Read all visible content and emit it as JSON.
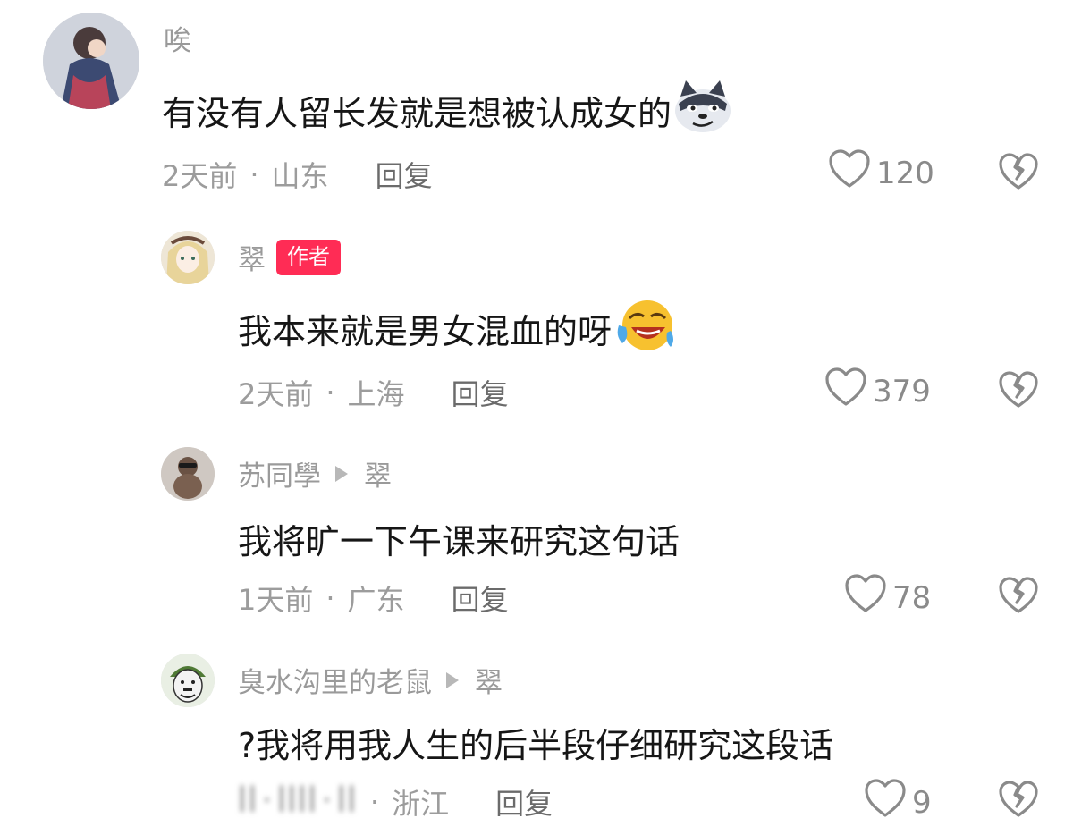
{
  "comments": [
    {
      "username": "唉",
      "content": "有没有人留长发就是想被认成女的",
      "emoji": "wolf-grin-emoji",
      "time": "2天前",
      "location": "山东",
      "reply_label": "回复",
      "likes": "120"
    },
    {
      "username": "翠",
      "badge": "作者",
      "content": "我本来就是男女混血的呀",
      "emoji": "laugh-cry-emoji",
      "time": "2天前",
      "location": "上海",
      "reply_label": "回复",
      "likes": "379"
    },
    {
      "username": "苏同學",
      "reply_to": "翠",
      "content": "我将旷一下午课来研究这句话",
      "time": "1天前",
      "location": "广东",
      "reply_label": "回复",
      "likes": "78"
    },
    {
      "username": "臭水沟里的老鼠",
      "reply_to": "翠",
      "content": "?我将用我人生的后半段仔细研究这段话",
      "time": "",
      "location": "浙江",
      "reply_label": "回复",
      "likes": "9"
    }
  ],
  "icons": {
    "like": "heart-outline-icon",
    "dislike": "broken-heart-icon"
  },
  "colors": {
    "author_badge": "#ff2c55",
    "meta_text": "#9c9c9c"
  }
}
